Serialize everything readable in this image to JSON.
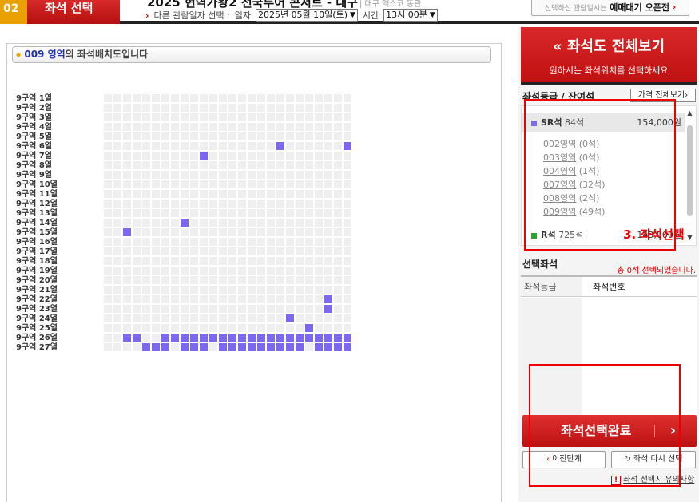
{
  "header": {
    "step_num": "02",
    "step_title": "좌석 선택",
    "performance_title": "2025 현역가왕2 전국투어 콘서트 - 대구",
    "venue": "| 대구 엑스코 동관",
    "date_prefix": "다른 관람일자 선택 :",
    "date_label": "일자",
    "date_value": "2025년 05월 10일(토)",
    "time_label": "시간",
    "time_value": "13시 00분",
    "wait_small": "선택하신 관람일시는",
    "wait_big": "예매대기 오픈전"
  },
  "seatmap": {
    "area_code": "009 영역",
    "title_suffix": "의 좌석배치도입니다",
    "rows": [
      "9구역 1열",
      "9구역 2열",
      "9구역 3열",
      "9구역 4열",
      "9구역 5열",
      "9구역 6열",
      "9구역 7열",
      "9구역 8열",
      "9구역 9열",
      "9구역 10열",
      "9구역 11열",
      "9구역 12열",
      "9구역 13열",
      "9구역 14열",
      "9구역 15열",
      "9구역 16열",
      "9구역 17열",
      "9구역 18열",
      "9구역 19열",
      "9구역 20열",
      "9구역 21열",
      "9구역 22열",
      "9구역 23열",
      "9구역 24열",
      "9구역 25열",
      "9구역 26열",
      "9구역 27열"
    ],
    "columns": 26,
    "available": [
      [
        5,
        18
      ],
      [
        5,
        25
      ],
      [
        6,
        10
      ],
      [
        13,
        8
      ],
      [
        14,
        2
      ],
      [
        21,
        23
      ],
      [
        22,
        23
      ],
      [
        23,
        19
      ],
      [
        24,
        21
      ],
      [
        25,
        2
      ],
      [
        25,
        3
      ],
      [
        25,
        6
      ],
      [
        25,
        7
      ],
      [
        25,
        8
      ],
      [
        25,
        9
      ],
      [
        25,
        10
      ],
      [
        25,
        11
      ],
      [
        25,
        12
      ],
      [
        25,
        13
      ],
      [
        25,
        14
      ],
      [
        25,
        15
      ],
      [
        25,
        16
      ],
      [
        25,
        17
      ],
      [
        25,
        18
      ],
      [
        25,
        19
      ],
      [
        25,
        20
      ],
      [
        25,
        21
      ],
      [
        25,
        22
      ],
      [
        25,
        23
      ],
      [
        25,
        24
      ],
      [
        25,
        25
      ],
      [
        26,
        4
      ],
      [
        26,
        5
      ],
      [
        26,
        6
      ],
      [
        26,
        8
      ],
      [
        26,
        9
      ],
      [
        26,
        10
      ],
      [
        26,
        12
      ],
      [
        26,
        13
      ],
      [
        26,
        14
      ],
      [
        26,
        15
      ],
      [
        26,
        16
      ],
      [
        26,
        17
      ],
      [
        26,
        18
      ],
      [
        26,
        19
      ],
      [
        26,
        20
      ],
      [
        26,
        22
      ],
      [
        26,
        23
      ],
      [
        26,
        24
      ],
      [
        26,
        25
      ]
    ],
    "seat_color": "#7b68ee",
    "empty_color": "#efefef"
  },
  "sidebar": {
    "view_all_title": "좌석도 전체보기",
    "view_all_icon": "double-chevron-left-icon",
    "view_all_sub": "원하시는 좌석위치를 선택하세요",
    "grade_heading": "좌석등급 / 잔여석",
    "price_all_btn": "가격 전체보기",
    "grades": [
      {
        "name": "SR석",
        "count": "84석",
        "price": "154,000원",
        "color": "#7b68ee"
      },
      {
        "name": "R석",
        "count": "725석",
        "price": "143,000원",
        "color": "#22aa22"
      }
    ],
    "zones": [
      {
        "name": "002영역",
        "count": "(0석)"
      },
      {
        "name": "003영역",
        "count": "(0석)"
      },
      {
        "name": "004영역",
        "count": "(1석)"
      },
      {
        "name": "007영역",
        "count": "(32석)"
      },
      {
        "name": "008영역",
        "count": "(2석)"
      },
      {
        "name": "009영역",
        "count": "(49석)"
      }
    ],
    "annotation": "3. 좌석선택",
    "selected_heading": "선택좌석",
    "selected_count": "총 0석 선택되었습니다.",
    "col_grade": "좌석등급",
    "col_seatno": "좌석번호",
    "complete_btn": "좌석선택완료",
    "prev_btn": "이전단계",
    "reset_btn": "좌석 다시 선택",
    "notice": "좌석 선택시 유의사항",
    "notice_mark": "!"
  }
}
